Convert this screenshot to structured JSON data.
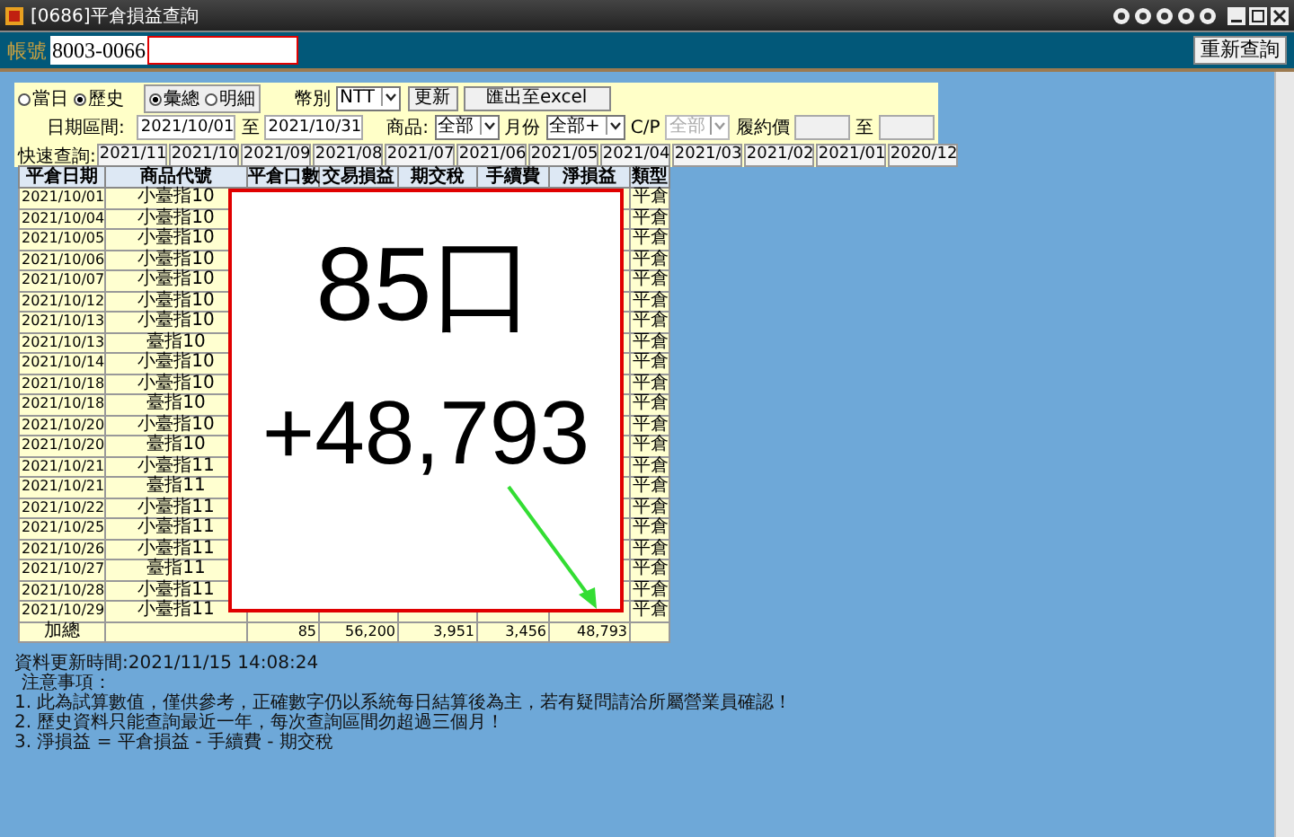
{
  "window": {
    "title": "[0686]平倉損益查詢"
  },
  "account": {
    "label": "帳號",
    "value": "8003-0066",
    "requery_button": "重新查詢"
  },
  "filters": {
    "range_options": [
      {
        "label": "當日",
        "selected": false
      },
      {
        "label": "歷史",
        "selected": true
      }
    ],
    "view_options": [
      {
        "label": "彙總",
        "selected": true
      },
      {
        "label": "明細",
        "selected": false
      }
    ],
    "currency": {
      "label": "幣別",
      "value": "NTT"
    },
    "buttons": [
      "更新",
      "匯出至excel"
    ],
    "date_range": {
      "label": "日期區間:",
      "from": "2021/10/01",
      "to_label": "至",
      "to": "2021/10/31"
    },
    "product": {
      "label": "商品:",
      "value": "全部"
    },
    "month": {
      "label": "月份",
      "value": "全部+"
    },
    "cp": {
      "label": "C/P",
      "value": "全部",
      "disabled": true
    },
    "strike": {
      "label": "履約價",
      "to_label": "至"
    },
    "quick": {
      "label": "快速查詢:",
      "months": [
        "2021/11",
        "2021/10",
        "2021/09",
        "2021/08",
        "2021/07",
        "2021/06",
        "2021/05",
        "2021/04",
        "2021/03",
        "2021/02",
        "2021/01",
        "2020/12"
      ]
    }
  },
  "table": {
    "columns": [
      "平倉日期",
      "商品代號",
      "平倉口數",
      "交易損益",
      "期交稅",
      "手續費",
      "淨損益",
      "類型"
    ],
    "rows": [
      {
        "date": "2021/10/01",
        "product": "小臺指10",
        "type": "平倉"
      },
      {
        "date": "2021/10/04",
        "product": "小臺指10",
        "type": "平倉"
      },
      {
        "date": "2021/10/05",
        "product": "小臺指10",
        "type": "平倉"
      },
      {
        "date": "2021/10/06",
        "product": "小臺指10",
        "type": "平倉"
      },
      {
        "date": "2021/10/07",
        "product": "小臺指10",
        "type": "平倉"
      },
      {
        "date": "2021/10/12",
        "product": "小臺指10",
        "type": "平倉"
      },
      {
        "date": "2021/10/13",
        "product": "小臺指10",
        "type": "平倉"
      },
      {
        "date": "2021/10/13",
        "product": "臺指10",
        "type": "平倉"
      },
      {
        "date": "2021/10/14",
        "product": "小臺指10",
        "type": "平倉"
      },
      {
        "date": "2021/10/18",
        "product": "小臺指10",
        "type": "平倉"
      },
      {
        "date": "2021/10/18",
        "product": "臺指10",
        "type": "平倉"
      },
      {
        "date": "2021/10/20",
        "product": "小臺指10",
        "type": "平倉"
      },
      {
        "date": "2021/10/20",
        "product": "臺指10",
        "type": "平倉"
      },
      {
        "date": "2021/10/21",
        "product": "小臺指11",
        "type": "平倉"
      },
      {
        "date": "2021/10/21",
        "product": "臺指11",
        "type": "平倉"
      },
      {
        "date": "2021/10/22",
        "product": "小臺指11",
        "type": "平倉"
      },
      {
        "date": "2021/10/25",
        "product": "小臺指11",
        "type": "平倉"
      },
      {
        "date": "2021/10/26",
        "product": "小臺指11",
        "type": "平倉"
      },
      {
        "date": "2021/10/27",
        "product": "臺指11",
        "type": "平倉"
      },
      {
        "date": "2021/10/28",
        "product": "小臺指11",
        "type": "平倉"
      },
      {
        "date": "2021/10/29",
        "product": "小臺指11",
        "type": "平倉"
      }
    ],
    "total": {
      "label": "加總",
      "values": [
        "85",
        "56,200",
        "3,951",
        "3,456",
        "48,793"
      ]
    }
  },
  "overlay": {
    "lots": "85口",
    "net": "+48,793"
  },
  "notes": {
    "updated": "資料更新時間:2021/11/15 14:08:24",
    "heading": "注意事項：",
    "items": [
      "1. 此為試算數值，僅供參考，正確數字仍以系統每日結算後為主，若有疑問請洽所屬營業員確認！",
      "2. 歷史資料只能查詢最近一年，每次查詢區間勿超過三個月！",
      "3. 淨損益 = 平倉損益 - 手續費 - 期交稅"
    ]
  }
}
